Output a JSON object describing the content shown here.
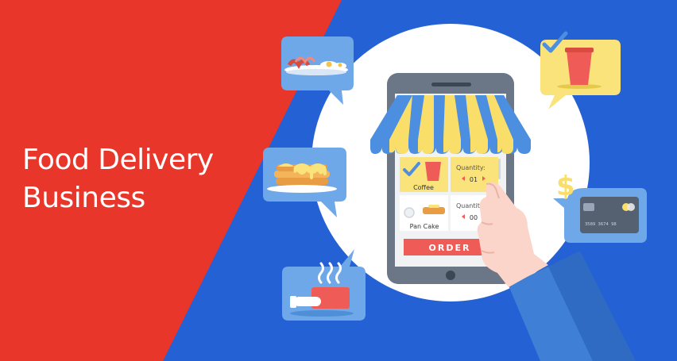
{
  "banner": {
    "headline_line1": "Food Delivery",
    "headline_line2": "Business",
    "colors": {
      "left_background": "#e8362b",
      "right_background": "#2461d4",
      "circle": "#ffffff",
      "bubble": "#6fa8e8",
      "bubble_accent": "#f9e37a",
      "awning_blue": "#4c8fe0",
      "awning_yellow": "#f9df6a",
      "order_button": "#ef5b57",
      "sleeve": "#3f7fd6"
    }
  },
  "phone": {
    "items": [
      {
        "name": "Coffee",
        "quantity_label": "Quantity:",
        "quantity": "01",
        "checked": true
      },
      {
        "name": "Pan Cake",
        "quantity_label": "Quantity:",
        "quantity": "00",
        "checked": false
      }
    ],
    "order_button": "ORDER"
  },
  "card": {
    "number": "3589 3674 98"
  },
  "icons": [
    "bacon-eggs-icon",
    "pancake-icon",
    "hot-food-delivery-icon",
    "drink-checked-icon",
    "credit-card-icon",
    "dollar-icon"
  ]
}
